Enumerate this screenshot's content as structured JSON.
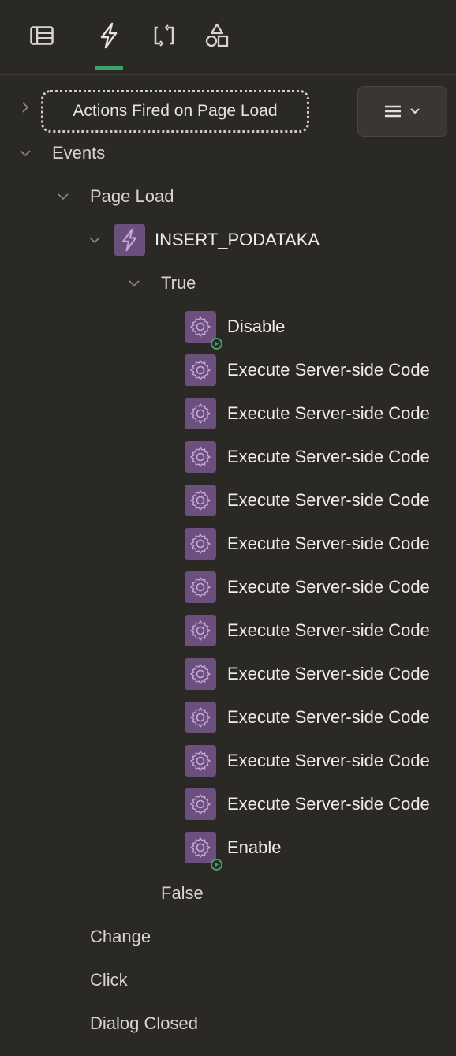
{
  "tabs": [
    {
      "name": "rendering",
      "icon": "rendering-icon"
    },
    {
      "name": "dynamic-actions",
      "icon": "lightning-icon",
      "active": true
    },
    {
      "name": "processing",
      "icon": "processing-icon"
    },
    {
      "name": "shared-components",
      "icon": "shapes-icon"
    }
  ],
  "toolbar": {
    "breadcrumb_label": "Actions Fired on Page Load",
    "menu_icon": "menu-icon"
  },
  "tree": {
    "events_label": "Events",
    "page_load_label": "Page Load",
    "dynamic_action_label": "INSERT_PODATAKA",
    "true_label": "True",
    "actions": [
      {
        "label": "Disable",
        "badge": true
      },
      {
        "label": "Execute Server-side Code"
      },
      {
        "label": "Execute Server-side Code"
      },
      {
        "label": "Execute Server-side Code"
      },
      {
        "label": "Execute Server-side Code"
      },
      {
        "label": "Execute Server-side Code"
      },
      {
        "label": "Execute Server-side Code"
      },
      {
        "label": "Execute Server-side Code"
      },
      {
        "label": "Execute Server-side Code"
      },
      {
        "label": "Execute Server-side Code"
      },
      {
        "label": "Execute Server-side Code"
      },
      {
        "label": "Execute Server-side Code"
      },
      {
        "label": "Enable",
        "badge": true
      }
    ],
    "false_label": "False",
    "other_events": [
      "Change",
      "Click",
      "Dialog Closed"
    ]
  },
  "colors": {
    "background": "#2b2925",
    "accent": "#3ea36a",
    "action_icon": "#6b4f7c"
  }
}
